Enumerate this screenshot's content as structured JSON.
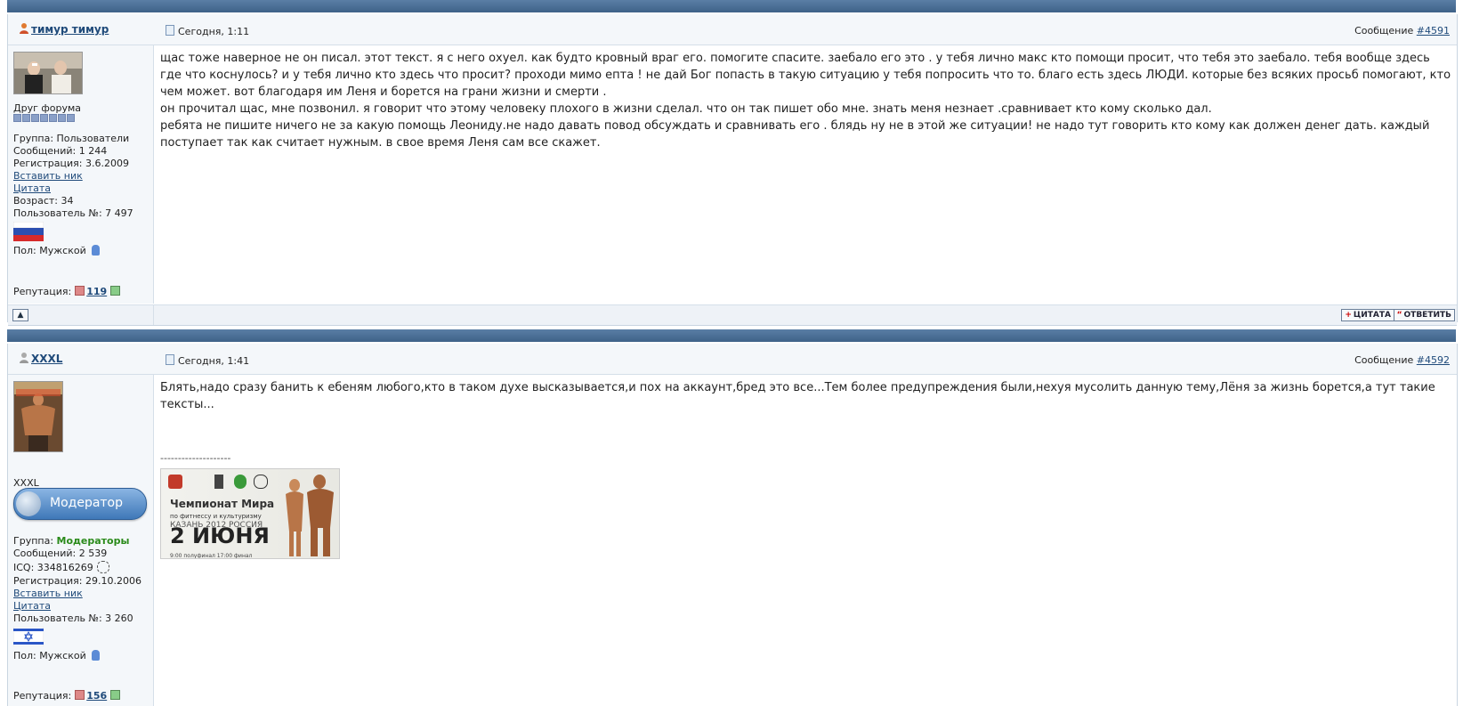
{
  "post1": {
    "author": "тимур тимур",
    "date": "Сегодня, 1:11",
    "msg_prefix": "Сообщение",
    "msg_no": "#4591",
    "rank": "Друг форума",
    "group": "Группа: Пользователи",
    "messages": "Сообщений: 1 244",
    "registered": "Регистрация: 3.6.2009",
    "insert_nick": "Вставить ник",
    "quote_link": "Цитата",
    "age": "Возраст: 34",
    "user_no": "Пользователь №: 7 497",
    "gender": "Пол: Мужской",
    "rep_label": "Репутация:",
    "rep_value": "119",
    "text1": "щас тоже наверное не он писал. этот текст. я с него охуел. как будто кровный враг его. помогите спасите. заебало его это . у тебя лично макс кто помощи просит, что тебя это заебало. тебя вообще здесь где что коснулось? и у тебя лично кто здесь что просит? проходи мимо епта ! не дай Бог попасть в такую ситуацию у тебя попросить что то. благо есть здесь ЛЮДИ. которые без всяких просьб помогают, кто чем может. вот благодаря им Леня и борется на грани жизни и смерти .",
    "text2": "он прочитал щас, мне позвонил. я говорит что этому человеку плохого в жизни сделал. что он так пишет обо мне. знать меня незнает .сравнивает кто кому сколько дал.",
    "text3": "ребята не пишите ничего не за какую помощь Леониду.не надо давать повод обсуждать и сравнивать его . блядь ну не в этой же ситуации! не надо тут говорить кто кому как должен денег дать. каждый поступает так как считает нужным. в свое время Леня сам все скажет.",
    "quote_btn": "ЦИТАТА",
    "reply_btn": "ОТВЕТИТЬ"
  },
  "post2": {
    "author": "XXXL",
    "date": "Сегодня, 1:41",
    "msg_prefix": "Сообщение",
    "msg_no": "#4592",
    "title_name": "XXXL",
    "badge": "Модератор",
    "group_label": "Группа:",
    "group_value": "Модераторы",
    "messages": "Сообщений: 2 539",
    "icq": "ICQ: 334816269",
    "registered": "Регистрация: 29.10.2006",
    "insert_nick": "Вставить ник",
    "quote_link": "Цитата",
    "user_no": "Пользователь №: 3 260",
    "gender": "Пол: Мужской",
    "rep_label": "Репутация:",
    "rep_value": "156",
    "text": "Блять,надо сразу банить к ебеням любого,кто в таком духе высказывается,и пох на аккаунт,бред это все...Тем более предупреждения были,нехуя мусолить данную тему,Лёня за жизнь борется,а тут такие тексты...",
    "signature_sep": "--------------------",
    "banner": {
      "line1": "Чемпионат Мира",
      "line2": "по фитнессу и культуризму",
      "line3": "КАЗАНЬ 2012 РОССИЯ",
      "line4": "2 ИЮНЯ",
      "line5": "9:00 полуфинал 17:00 финал"
    }
  },
  "icons": {
    "online_user": "user-online-icon",
    "offline_user": "user-offline-icon",
    "post_doc": "post-doc-icon",
    "scroll_up": "up-arrow-icon",
    "rep_minus": "minus-icon",
    "rep_plus": "plus-icon",
    "male": "male-icon",
    "icq": "icq-flower-icon"
  },
  "colors": {
    "bar": "#4a6f96",
    "link": "#1f4a7a",
    "moderator_group": "#2a8a1a"
  }
}
